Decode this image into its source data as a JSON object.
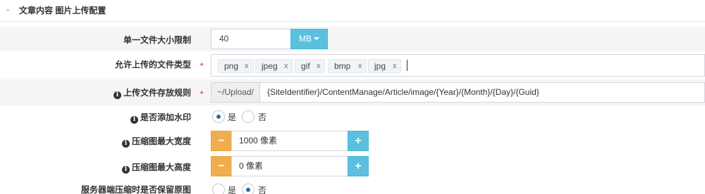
{
  "section": {
    "toggle": "-",
    "title": "文章内容 图片上传配置"
  },
  "size_limit": {
    "label": "单一文件大小限制",
    "value": "40",
    "unit_button": "MB"
  },
  "file_types": {
    "label": "允许上传的文件类型",
    "required": "*",
    "tags": [
      "png",
      "jpeg",
      "gif",
      "bmp",
      "jpg"
    ],
    "remove_glyph": "x"
  },
  "storage_rule": {
    "info": "i",
    "label": "上传文件存放规则",
    "required": "*",
    "prefix": "~/Upload/",
    "value": "{SiteIdentifier}/ContentManage/Article/image/{Year}/{Month}/{Day}/{Guid}"
  },
  "watermark": {
    "info": "i",
    "label": "是否添加水印",
    "options": [
      "是",
      "否"
    ],
    "selected": "是"
  },
  "max_width": {
    "info": "i",
    "label": "压缩图最大宽度",
    "value": "1000 像素",
    "minus": "−",
    "plus": "+"
  },
  "max_height": {
    "info": "i",
    "label": "压缩图最大高度",
    "value": "0 像素",
    "minus": "−",
    "plus": "+"
  },
  "keep_original": {
    "label": "服务器端压缩时是否保留原图",
    "options": [
      "是",
      "否"
    ],
    "selected": "否"
  },
  "colors": {
    "accent_blue": "#5bc0de",
    "accent_orange": "#f0ad4e",
    "required_red": "#e74c3c",
    "radio_selected": "#1e6fb0"
  }
}
